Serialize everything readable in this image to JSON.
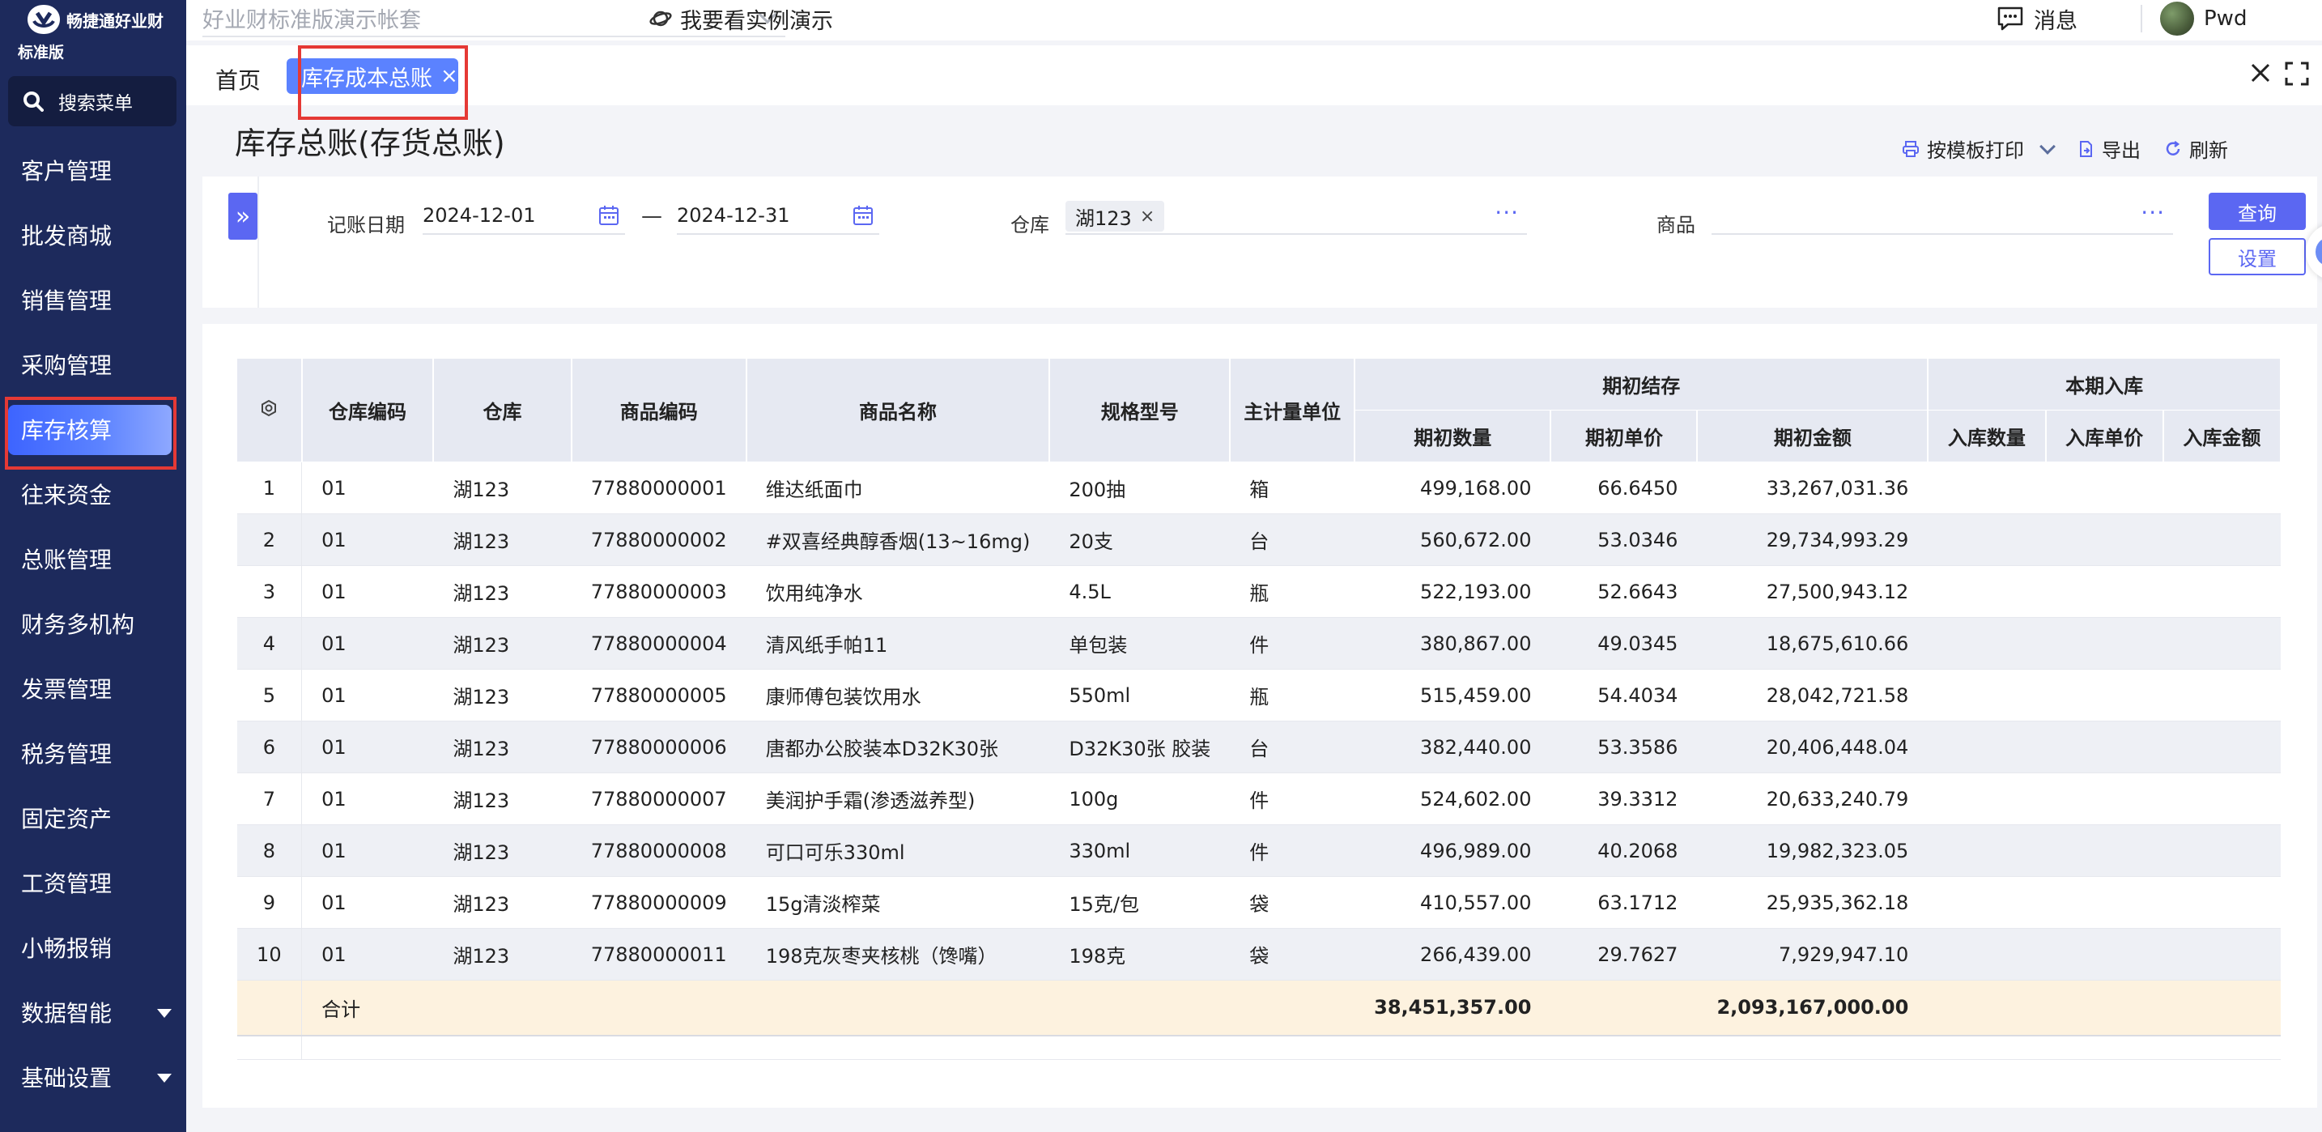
{
  "app": {
    "logo_text": "畅捷通好业财",
    "edition": "标准版",
    "search_menu_label": "搜索菜单"
  },
  "sidebar": {
    "items": [
      {
        "label": "客户管理"
      },
      {
        "label": "批发商城"
      },
      {
        "label": "销售管理"
      },
      {
        "label": "采购管理"
      },
      {
        "label": "库存核算",
        "active": true
      },
      {
        "label": "往来资金"
      },
      {
        "label": "总账管理"
      },
      {
        "label": "财务多机构"
      },
      {
        "label": "发票管理"
      },
      {
        "label": "税务管理"
      },
      {
        "label": "固定资产"
      },
      {
        "label": "工资管理"
      },
      {
        "label": "小畅报销"
      },
      {
        "label": "数据智能",
        "has_caret": true
      },
      {
        "label": "基础设置",
        "has_caret": true
      }
    ]
  },
  "header": {
    "account_set": "好业财标准版演示帐套",
    "demo_link": "我要看实例演示",
    "messages_label": "消息",
    "user_name": "Pwd"
  },
  "tabs": {
    "home": "首页",
    "active": "库存成本总账",
    "close_symbol": "×"
  },
  "page": {
    "title": "库存总账(存货总账)",
    "actions": {
      "print": "按模板打印",
      "export": "导出",
      "refresh": "刷新"
    }
  },
  "filters": {
    "date_label": "记账日期",
    "date_from": "2024-12-01",
    "date_to": "2024-12-31",
    "date_separator": "—",
    "warehouse_label": "仓库",
    "warehouse_chip": "湖123",
    "goods_label": "商品",
    "goods_value": "",
    "query_button": "查询",
    "settings_button": "设置",
    "ellipsis": "···"
  },
  "table": {
    "headers": {
      "warehouse_code": "仓库编码",
      "warehouse": "仓库",
      "goods_code": "商品编码",
      "goods_name": "商品名称",
      "spec": "规格型号",
      "unit": "主计量单位",
      "opening_group": "期初结存",
      "opening_qty": "期初数量",
      "opening_price": "期初单价",
      "opening_amount": "期初金额",
      "inbound_group": "本期入库",
      "inbound_qty": "入库数量",
      "inbound_price": "入库单价",
      "inbound_amount": "入库金额"
    },
    "rows": [
      {
        "idx": "1",
        "wh_code": "01",
        "wh": "湖123",
        "code": "77880000001",
        "name": "维达纸面巾",
        "spec": "200抽",
        "unit": "箱",
        "qty": "499,168.00",
        "price": "66.6450",
        "amount": "33,267,031.36"
      },
      {
        "idx": "2",
        "wh_code": "01",
        "wh": "湖123",
        "code": "77880000002",
        "name": "#双喜经典醇香烟(13~16mg)",
        "spec": "20支",
        "unit": "台",
        "qty": "560,672.00",
        "price": "53.0346",
        "amount": "29,734,993.29"
      },
      {
        "idx": "3",
        "wh_code": "01",
        "wh": "湖123",
        "code": "77880000003",
        "name": "饮用纯净水",
        "spec": "4.5L",
        "unit": "瓶",
        "qty": "522,193.00",
        "price": "52.6643",
        "amount": "27,500,943.12"
      },
      {
        "idx": "4",
        "wh_code": "01",
        "wh": "湖123",
        "code": "77880000004",
        "name": "清风纸手帕11",
        "spec": "单包装",
        "unit": "件",
        "qty": "380,867.00",
        "price": "49.0345",
        "amount": "18,675,610.66"
      },
      {
        "idx": "5",
        "wh_code": "01",
        "wh": "湖123",
        "code": "77880000005",
        "name": "康师傅包装饮用水",
        "spec": "550ml",
        "unit": "瓶",
        "qty": "515,459.00",
        "price": "54.4034",
        "amount": "28,042,721.58"
      },
      {
        "idx": "6",
        "wh_code": "01",
        "wh": "湖123",
        "code": "77880000006",
        "name": "唐都办公胶装本D32K30张",
        "spec": "D32K30张 胶装",
        "unit": "台",
        "qty": "382,440.00",
        "price": "53.3586",
        "amount": "20,406,448.04"
      },
      {
        "idx": "7",
        "wh_code": "01",
        "wh": "湖123",
        "code": "77880000007",
        "name": "美润护手霜(渗透滋养型)",
        "spec": "100g",
        "unit": "件",
        "qty": "524,602.00",
        "price": "39.3312",
        "amount": "20,633,240.79"
      },
      {
        "idx": "8",
        "wh_code": "01",
        "wh": "湖123",
        "code": "77880000008",
        "name": "可口可乐330ml",
        "spec": "330ml",
        "unit": "件",
        "qty": "496,989.00",
        "price": "40.2068",
        "amount": "19,982,323.05"
      },
      {
        "idx": "9",
        "wh_code": "01",
        "wh": "湖123",
        "code": "77880000009",
        "name": "15g清淡榨菜",
        "spec": "15克/包",
        "unit": "袋",
        "qty": "410,557.00",
        "price": "63.1712",
        "amount": "25,935,362.18"
      },
      {
        "idx": "10",
        "wh_code": "01",
        "wh": "湖123",
        "code": "77880000011",
        "name": "198克灰枣夹核桃（馋嘴）",
        "spec": "198克",
        "unit": "袋",
        "qty": "266,439.00",
        "price": "29.7627",
        "amount": "7,929,947.10"
      }
    ],
    "total": {
      "label": "合计",
      "qty": "38,451,357.00",
      "amount": "2,093,167,000.00"
    }
  },
  "colors": {
    "sidebar_bg": "#1d2a5c",
    "accent": "#5b67f2",
    "tab_active": "#5b82ff",
    "highlight_border": "#e53935",
    "total_row_bg": "#fdf2df"
  }
}
